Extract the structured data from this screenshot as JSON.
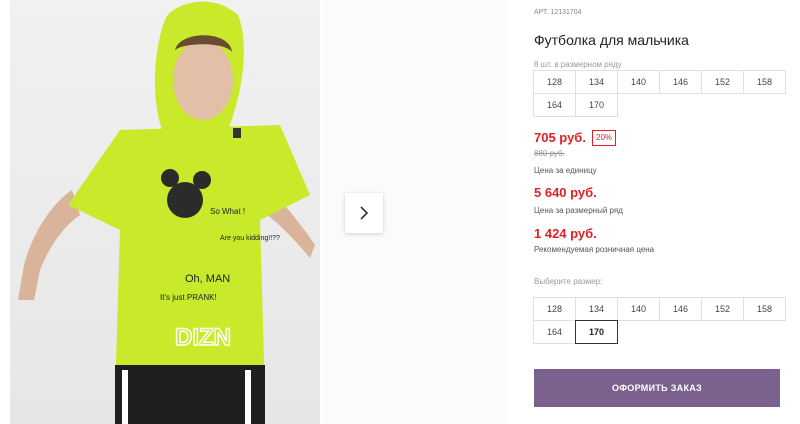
{
  "product": {
    "article": "АРТ. 12131704",
    "title": "Футболка для мальчика",
    "size_range_note": "8 шт. в размерном ряду",
    "range_sizes": [
      "128",
      "134",
      "140",
      "146",
      "152",
      "158",
      "164",
      "170"
    ]
  },
  "pricing": {
    "unit_price": "705 руб.",
    "discount_badge": "20%",
    "old_price": "880 руб.",
    "unit_label": "Цена за единицу",
    "range_price": "5 640 руб.",
    "range_label": "Цена за размерный ряд",
    "retail_price": "1 424 руб.",
    "retail_label": "Рекомендуемая розничная цена",
    "accent_color": "#e02127"
  },
  "size_select": {
    "label": "Выберите размер:",
    "sizes": [
      "128",
      "134",
      "140",
      "146",
      "152",
      "158",
      "164",
      "170"
    ],
    "selected": "170"
  },
  "order": {
    "button_label": "ОФОРМИТЬ ЗАКАЗ",
    "button_color": "#7b628e"
  },
  "gallery": {
    "print_text": [
      "So What !",
      "Are you kidding!!??",
      "Oh, MAN",
      "It's just PRANK!",
      "DIZN"
    ],
    "next_icon": "chevron-right-icon"
  }
}
